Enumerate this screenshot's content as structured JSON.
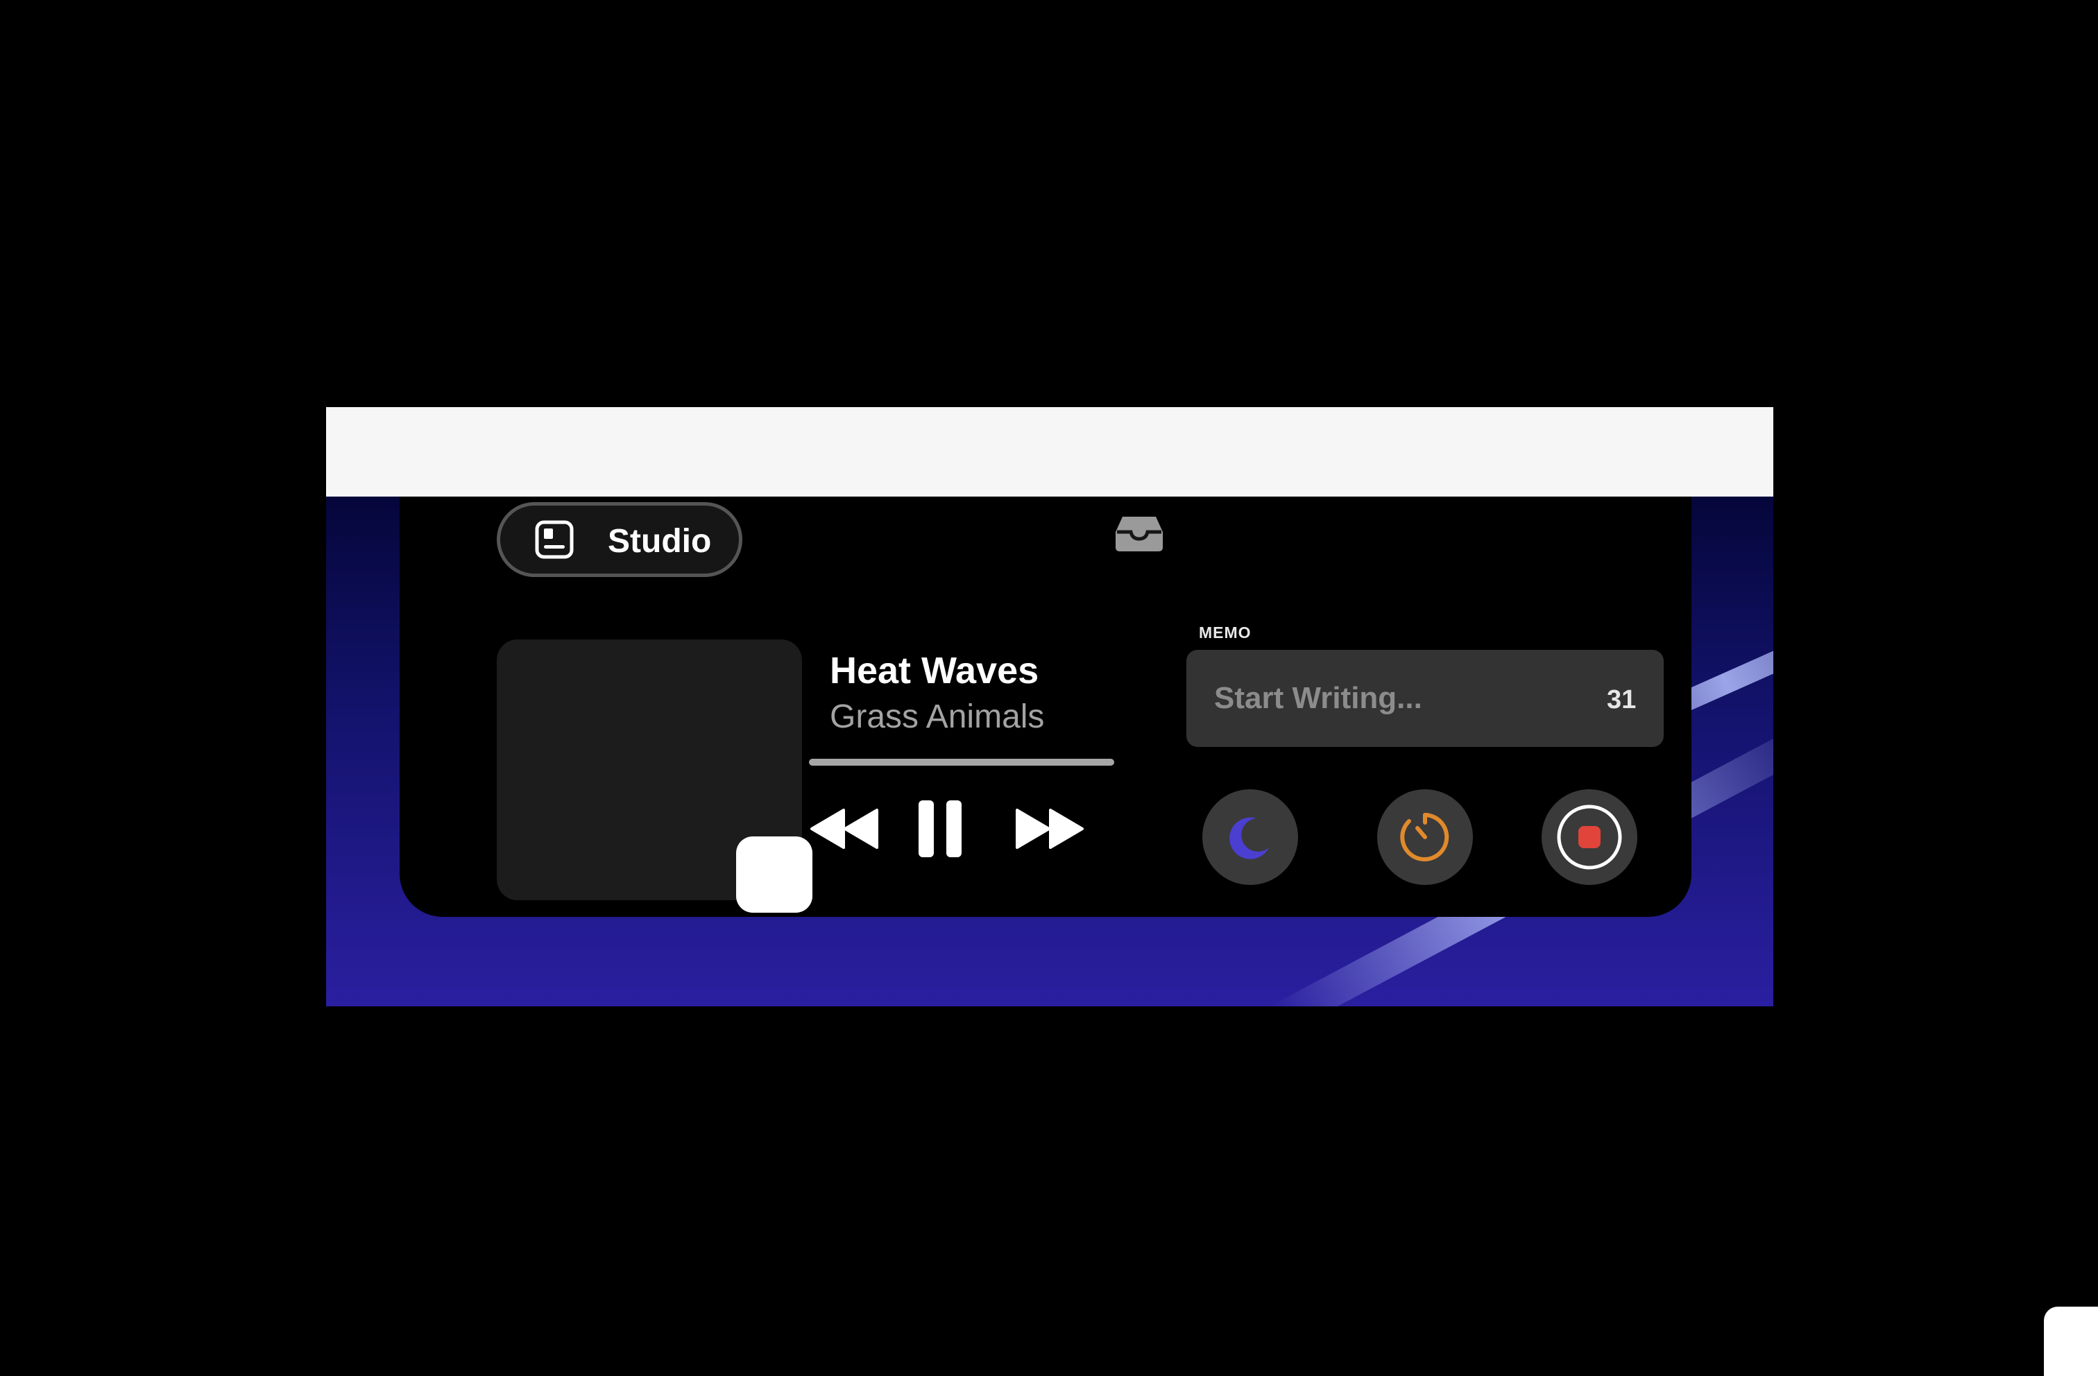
{
  "studio": {
    "label": "Studio"
  },
  "player": {
    "title": "Heat Waves",
    "artist": "Grass Animals",
    "progress": 1.0
  },
  "memo": {
    "label": "MEMO",
    "placeholder": "Start Writing...",
    "count": "31"
  },
  "colors": {
    "moon": "#4a3fd0",
    "timer": "#e08a2c",
    "record": "#e0443a"
  },
  "icons": {
    "studio": "widget-panel-icon",
    "tray": "inbox-tray-icon",
    "rewind": "rewind-icon",
    "pause": "pause-icon",
    "fast_forward": "fast-forward-icon",
    "moon": "moon-icon",
    "timer": "timer-icon",
    "record": "record-icon"
  }
}
